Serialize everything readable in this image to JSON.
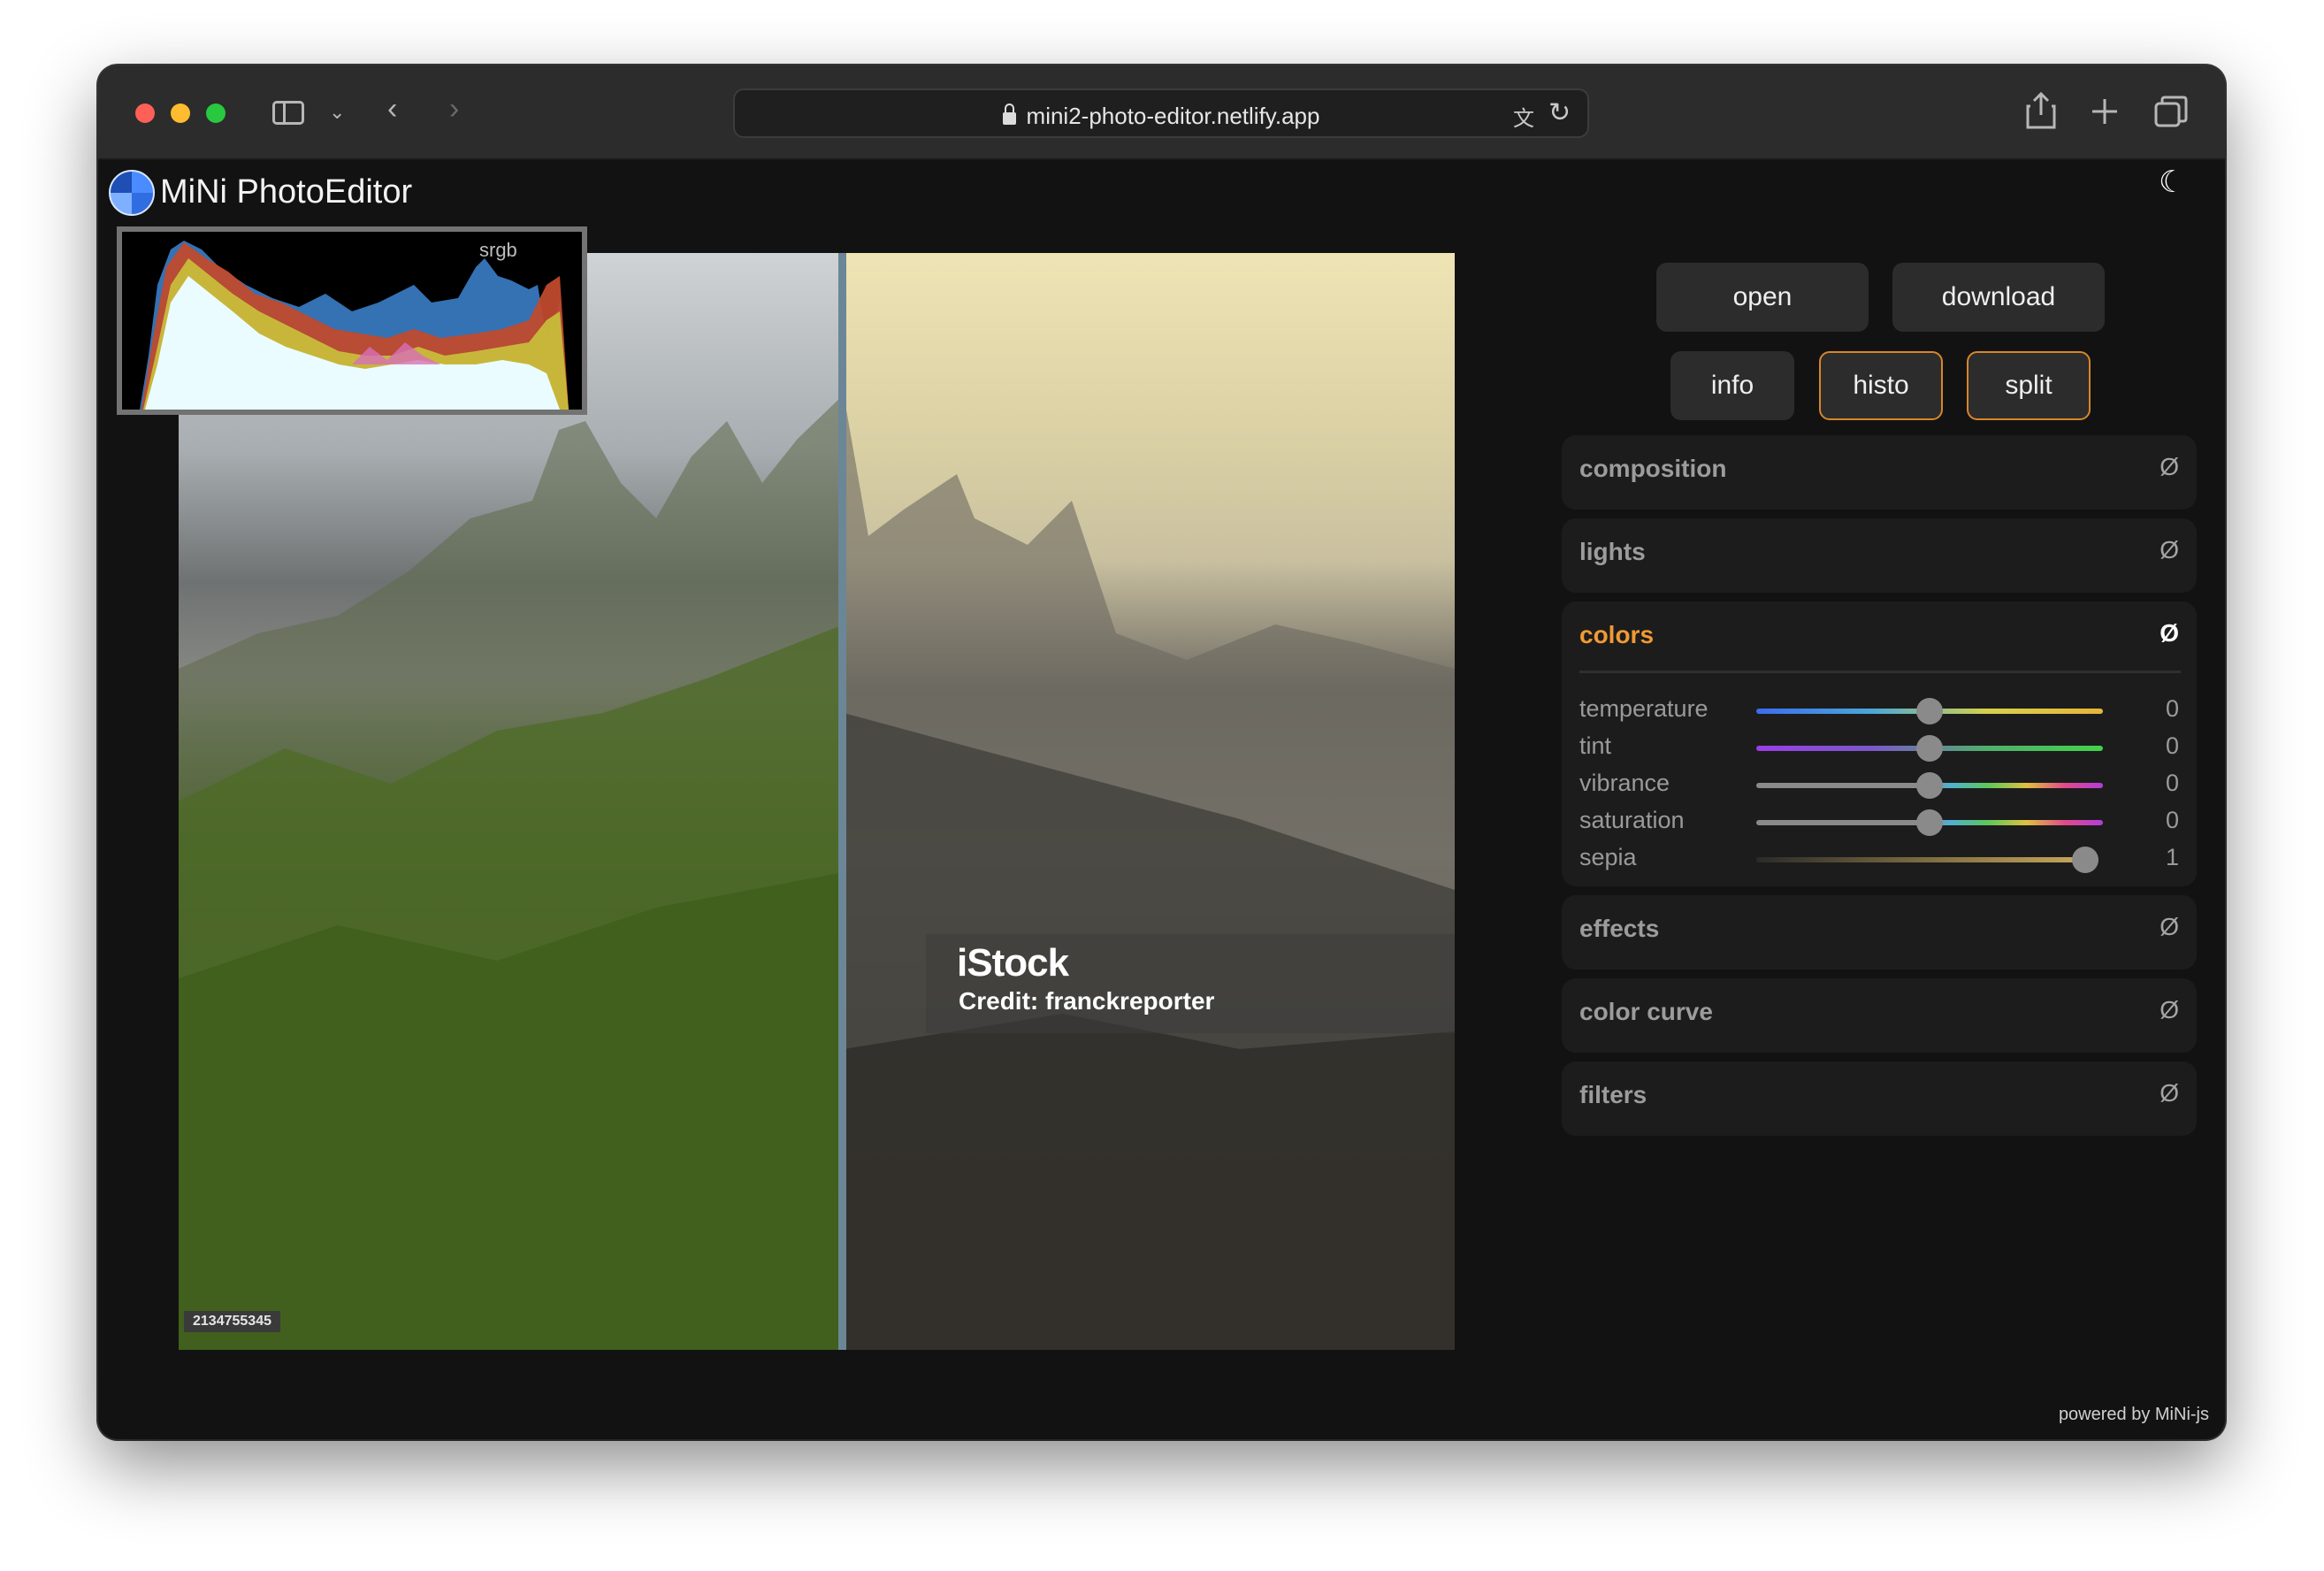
{
  "browser": {
    "url": "mini2-photo-editor.netlify.app"
  },
  "app": {
    "title": "MiNi PhotoEditor",
    "footer": "powered by MiNi-js"
  },
  "toolbar": {
    "open_label": "open",
    "download_label": "download",
    "info_label": "info",
    "histo_label": "histo",
    "split_label": "split",
    "active_toggles": [
      "histo",
      "split"
    ]
  },
  "histogram": {
    "colorspace_label": "srgb"
  },
  "photo": {
    "watermark_brand": "iStock",
    "watermark_credit": "Credit: franckreporter",
    "image_id": "2134755345",
    "split_position": 0.52
  },
  "panels": [
    {
      "title": "composition",
      "reset": "Ø",
      "open": false
    },
    {
      "title": "lights",
      "reset": "Ø",
      "open": false
    },
    {
      "title": "colors",
      "reset": "Ø",
      "open": true
    },
    {
      "title": "effects",
      "reset": "Ø",
      "open": false
    },
    {
      "title": "color curve",
      "reset": "Ø",
      "open": false
    },
    {
      "title": "filters",
      "reset": "Ø",
      "open": false
    }
  ],
  "colors_sliders": [
    {
      "label": "temperature",
      "value": "0",
      "min": -1,
      "max": 1
    },
    {
      "label": "tint",
      "value": "0",
      "min": -1,
      "max": 1
    },
    {
      "label": "vibrance",
      "value": "0",
      "min": -1,
      "max": 1
    },
    {
      "label": "saturation",
      "value": "0",
      "min": -1,
      "max": 1
    },
    {
      "label": "sepia",
      "value": "1",
      "min": -1,
      "max": 1
    }
  ],
  "accent_color": "#f09a34",
  "icons": [
    "sidebar-icon",
    "chevron-down-icon",
    "back-icon",
    "forward-icon",
    "lock-icon",
    "translate-icon",
    "reload-icon",
    "share-icon",
    "plus-icon",
    "tabs-icon",
    "logo-icon",
    "moon-icon",
    "reset-icon"
  ]
}
